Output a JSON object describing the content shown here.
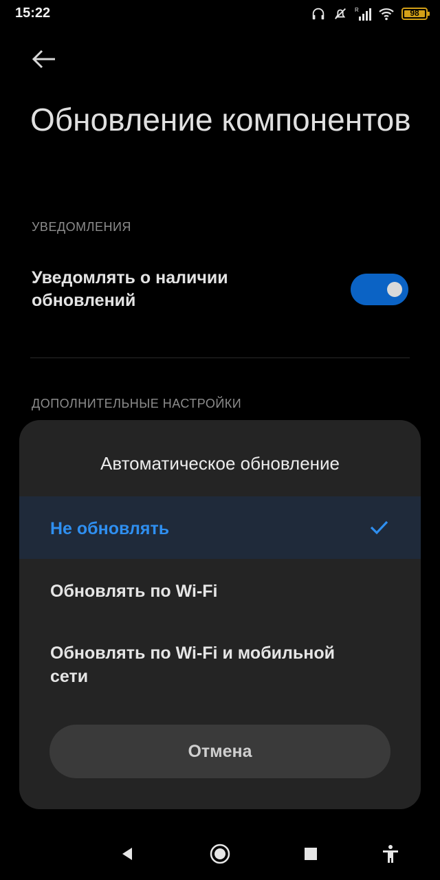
{
  "status_bar": {
    "time": "15:22",
    "battery_level": "98",
    "icons": [
      "headphones-icon",
      "alarm-off-icon",
      "signal-icon",
      "wifi-icon",
      "battery-icon"
    ]
  },
  "header": {
    "back_icon": "arrow-left-icon",
    "title": "Обновление компонентов"
  },
  "sections": {
    "notifications_label": "УВЕДОМЛЕНИЯ",
    "notify_setting": {
      "label": "Уведомлять о наличии обновлений",
      "enabled": true
    },
    "advanced_label": "ДОПОЛНИТЕЛЬНЫЕ НАСТРОЙКИ"
  },
  "dialog": {
    "title": "Автоматическое обновление",
    "options": [
      {
        "label": "Не обновлять",
        "selected": true
      },
      {
        "label": "Обновлять по Wi-Fi",
        "selected": false
      },
      {
        "label": "Обновлять по Wi-Fi и мобильной сети",
        "selected": false
      }
    ],
    "cancel_label": "Отмена"
  },
  "colors": {
    "accent": "#2f8ff0",
    "toggle_on": "#0b63c5",
    "battery": "#d4a017"
  },
  "nav_bar": {
    "icons": [
      "back-triangle-icon",
      "home-circle-icon",
      "recents-square-icon",
      "accessibility-icon"
    ]
  }
}
